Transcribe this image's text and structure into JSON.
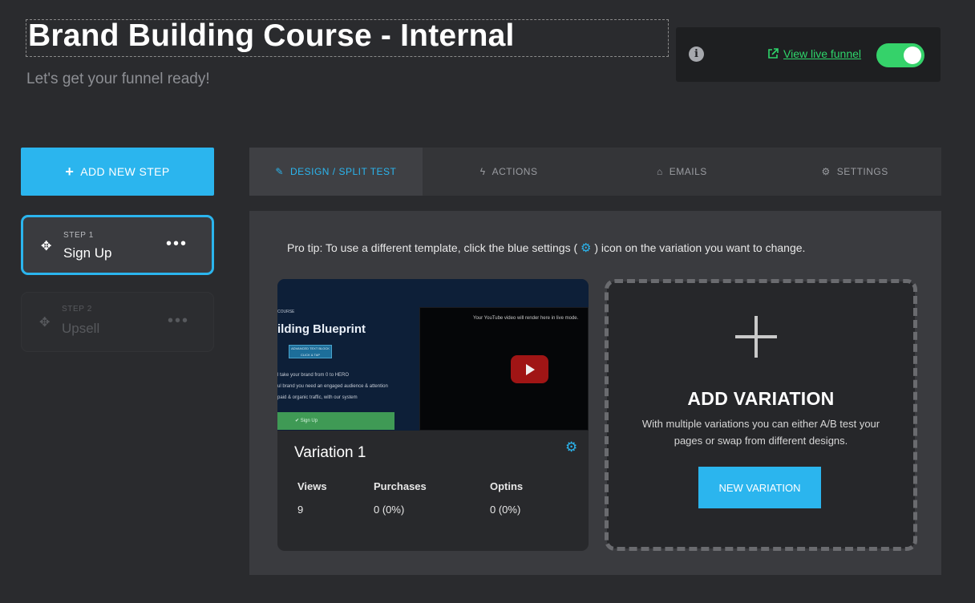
{
  "header": {
    "title": "Brand Building Course - Internal",
    "subtitle": "Let's get your funnel ready!",
    "view_live_funnel": "View live funnel",
    "live_toggle_on": true
  },
  "sidebar": {
    "add_step_label": "ADD NEW STEP",
    "steps": [
      {
        "kicker": "STEP 1",
        "name": "Sign Up",
        "active": true
      },
      {
        "kicker": "STEP 2",
        "name": "Upsell",
        "active": false
      }
    ]
  },
  "tabs": [
    {
      "label": "DESIGN / SPLIT TEST",
      "icon": "pencil-icon",
      "active": true
    },
    {
      "label": "ACTIONS",
      "icon": "bolt-icon",
      "active": false
    },
    {
      "label": "EMAILS",
      "icon": "inbox-icon",
      "active": false
    },
    {
      "label": "SETTINGS",
      "icon": "cogs-icon",
      "active": false
    }
  ],
  "main": {
    "pro_tip_before": "Pro tip: To use a different template, click the blue settings (",
    "pro_tip_after": ") icon on the variation you want to change.",
    "variation": {
      "title": "Variation 1",
      "thumbnail": {
        "course": "COURSE",
        "headline": "ilding Blueprint",
        "button": "ADVANCED TEXT BLOCK CLICK & TAP",
        "lines": [
          "l take your brand from 0 to HERO",
          "ul brand you need an engaged audience & attention",
          "paid & organic traffic, with our system"
        ],
        "signup": "✔ Sign Up",
        "video_text": "Your YouTube video will render here in live mode."
      },
      "stats": [
        {
          "label": "Views",
          "value": "9"
        },
        {
          "label": "Purchases",
          "value": "0 (0%)"
        },
        {
          "label": "Optins",
          "value": "0 (0%)"
        }
      ]
    },
    "add_variation": {
      "title": "ADD VARIATION",
      "description": "With multiple variations you can either A/B test your pages or swap from different designs.",
      "button_label": "NEW VARIATION"
    }
  },
  "colors": {
    "accent": "#2bb5ee",
    "toggle_green": "#35d26a",
    "link_green": "#2ed66b",
    "background": "#2a2b2e"
  }
}
